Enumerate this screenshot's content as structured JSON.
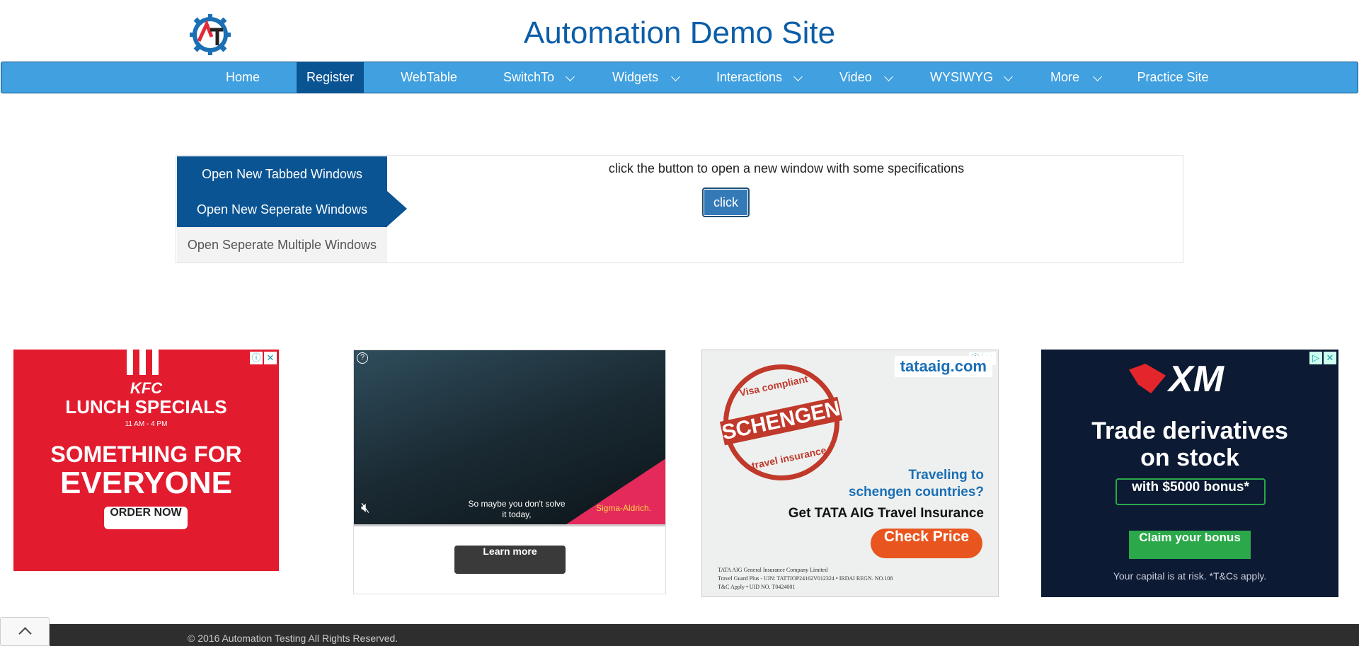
{
  "header": {
    "title": "Automation Demo Site"
  },
  "nav": {
    "items": [
      {
        "label": "Home",
        "dropdown": false,
        "active": false
      },
      {
        "label": "Register",
        "dropdown": false,
        "active": true
      },
      {
        "label": "WebTable",
        "dropdown": false,
        "active": false
      },
      {
        "label": "SwitchTo",
        "dropdown": true,
        "active": false
      },
      {
        "label": "Widgets",
        "dropdown": true,
        "active": false
      },
      {
        "label": "Interactions",
        "dropdown": true,
        "active": false
      },
      {
        "label": "Video",
        "dropdown": true,
        "active": false
      },
      {
        "label": "WYSIWYG",
        "dropdown": true,
        "active": false
      },
      {
        "label": "More",
        "dropdown": true,
        "active": false
      },
      {
        "label": "Practice Site",
        "dropdown": false,
        "active": false
      }
    ]
  },
  "windows": {
    "tabs": [
      {
        "label": "Open New Tabbed Windows"
      },
      {
        "label": "Open New Seperate Windows"
      },
      {
        "label": "Open Seperate Multiple Windows"
      }
    ],
    "instruction": "click the button to open a new window with some specifications",
    "button_label": "click"
  },
  "ads": {
    "kfc": {
      "brand": "KFC",
      "headline1": "LUNCH SPECIALS",
      "hours": "11 AM - 4 PM",
      "headline2": "SOMETHING FOR",
      "headline3": "EVERYONE",
      "cta": "ORDER NOW"
    },
    "video": {
      "caption": "So maybe you don't solve it today,",
      "brand": "Sigma-Aldrich.",
      "cta": "Learn more"
    },
    "tata": {
      "brand": "tataaig.com",
      "stamp1": "Visa compliant",
      "stamp2": "SCHENGEN",
      "stamp3": "travel insurance",
      "line1": "Traveling to",
      "line2": "schengen countries?",
      "line3": "Get TATA AIG Travel Insurance",
      "cta": "Check Price",
      "fine1": "TATA AIG General Insurance Company Limited",
      "fine2": "Travel Guard Plus - UIN: TATTIOP24162V012324 • IRDAI REGN. NO.108",
      "fine3": "T&C Apply • UID NO. T0424001"
    },
    "xm": {
      "brand": "XM",
      "line1": "Trade derivatives",
      "line2": "on stock",
      "bonus": "with $5000 bonus*",
      "cta": "Claim your bonus",
      "disclaimer": "Your capital is at risk. *T&Cs apply."
    }
  },
  "footer": {
    "text": "© 2016 Automation Testing All Rights Reserved."
  },
  "colors": {
    "nav_bg": "#40a0e0",
    "nav_active": "#0a5494",
    "title": "#0b5ea8"
  }
}
